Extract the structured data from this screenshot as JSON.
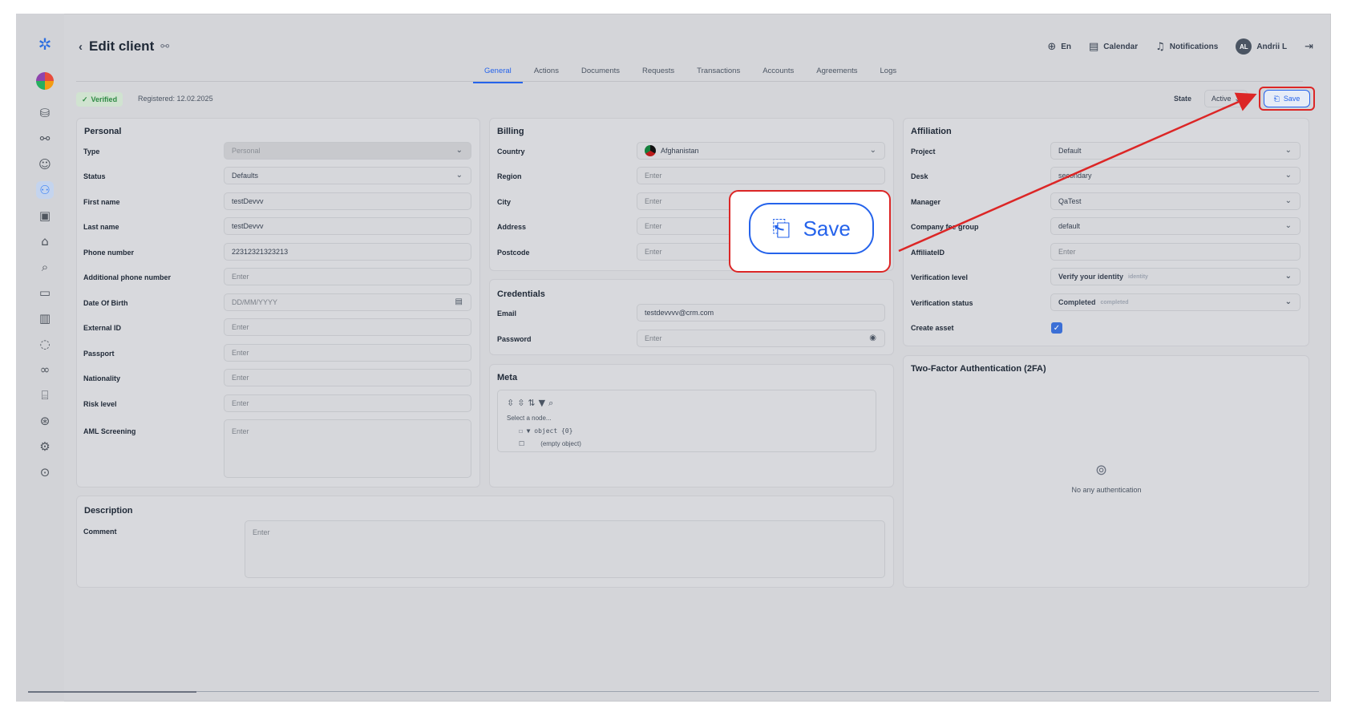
{
  "header": {
    "title": "Edit client",
    "language": "En",
    "calendar": "Calendar",
    "notifications": "Notifications",
    "avatar_initials": "AL",
    "user_name": "Andrii L"
  },
  "tabs": [
    "General",
    "Actions",
    "Documents",
    "Requests",
    "Transactions",
    "Accounts",
    "Agreements",
    "Logs"
  ],
  "status_bar": {
    "verified": "Verified",
    "registered": "Registered: 12.02.2025",
    "state_label": "State",
    "state_value": "Active",
    "save_label": "Save"
  },
  "personal": {
    "title": "Personal",
    "rows": [
      {
        "label": "Type",
        "value": "Personal"
      },
      {
        "label": "Status",
        "value": "Defaults"
      },
      {
        "label": "First name",
        "value": "testDevvv"
      },
      {
        "label": "Last name",
        "value": "testDevvv"
      },
      {
        "label": "Phone number",
        "value": "22312321323213"
      },
      {
        "label": "Additional phone number",
        "placeholder": "Enter"
      },
      {
        "label": "Date Of Birth",
        "placeholder": "DD/MM/YYYY"
      },
      {
        "label": "External ID",
        "placeholder": "Enter"
      },
      {
        "label": "Passport",
        "placeholder": "Enter"
      },
      {
        "label": "Nationality",
        "placeholder": "Enter"
      },
      {
        "label": "Risk level",
        "placeholder": "Enter"
      },
      {
        "label": "AML Screening",
        "placeholder": "Enter"
      }
    ]
  },
  "billing": {
    "title": "Billing",
    "rows": [
      {
        "label": "Country",
        "value": "Afghanistan"
      },
      {
        "label": "Region",
        "placeholder": "Enter"
      },
      {
        "label": "City",
        "placeholder": "Enter"
      },
      {
        "label": "Address",
        "placeholder": "Enter"
      },
      {
        "label": "Postcode",
        "placeholder": "Enter"
      }
    ]
  },
  "credentials": {
    "title": "Credentials",
    "email_label": "Email",
    "email_value": "testdevvvv@crm.com",
    "password_label": "Password",
    "password_placeholder": "Enter"
  },
  "meta": {
    "title": "Meta",
    "select_node": "Select a node...",
    "tree_root": "object {0}",
    "tree_empty": "(empty object)"
  },
  "affiliation": {
    "title": "Affiliation",
    "rows": [
      {
        "label": "Project",
        "value": "Default"
      },
      {
        "label": "Desk",
        "value": "secondary"
      },
      {
        "label": "Manager",
        "value": "QaTest"
      },
      {
        "label": "Company fee group",
        "value": "default"
      },
      {
        "label": "AffiliateID",
        "placeholder": "Enter"
      },
      {
        "label": "Verification level",
        "value": "Verify your identity",
        "tag": "identity"
      },
      {
        "label": "Verification status",
        "value": "Completed",
        "tag": "completed"
      },
      {
        "label": "Create asset",
        "checked": true
      }
    ]
  },
  "twofa": {
    "title": "Two-Factor Authentication (2FA)",
    "empty": "No any authentication"
  },
  "description": {
    "title": "Description",
    "comment_label": "Comment",
    "comment_placeholder": "Enter"
  },
  "callout": {
    "label": "Save",
    "highlight_color": "#dc2626",
    "accent_color": "#2563eb"
  }
}
